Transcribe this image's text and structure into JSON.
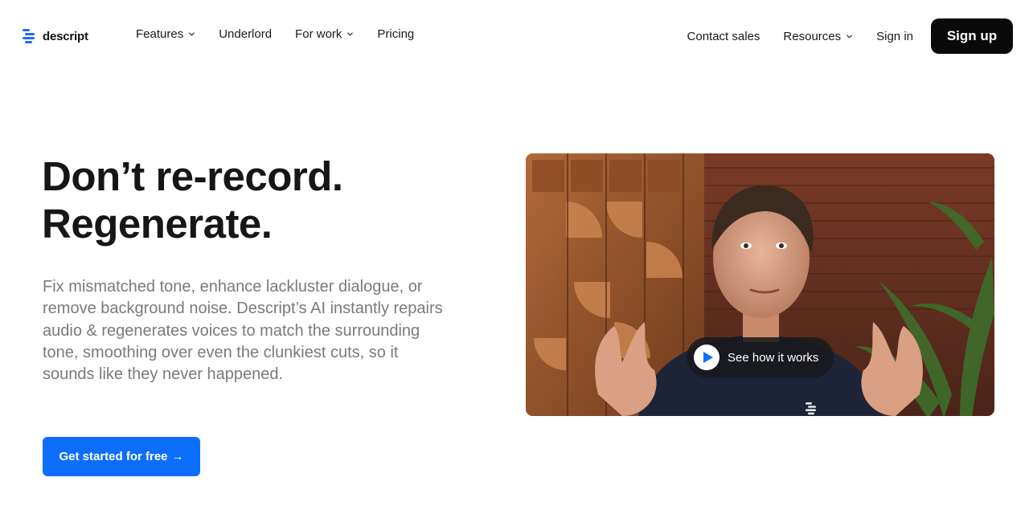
{
  "brand": {
    "name": "descript",
    "accent": "#0d6efd"
  },
  "nav": {
    "left": [
      {
        "label": "Features",
        "dropdown": true
      },
      {
        "label": "Underlord",
        "dropdown": false
      },
      {
        "label": "For work",
        "dropdown": true
      },
      {
        "label": "Pricing",
        "dropdown": false
      }
    ],
    "right": [
      {
        "label": "Contact sales",
        "dropdown": false
      },
      {
        "label": "Resources",
        "dropdown": true
      },
      {
        "label": "Sign in",
        "dropdown": false
      }
    ],
    "signup_label": "Sign up"
  },
  "hero": {
    "headline_line1": "Don’t re-record.",
    "headline_line2": "Regenerate.",
    "subtext": "Fix mismatched tone, enhance lackluster dialogue, or remove background noise. Descript’s AI instantly repairs audio & regenerates voices to match the surrounding tone, smoothing over even the clunkiest cuts, so it sounds like they never happened.",
    "cta_label": "Get started for free",
    "cta_arrow": "→"
  },
  "video": {
    "play_label": "See how it works",
    "icons": [
      "play-icon",
      "descript-logo-icon"
    ]
  }
}
